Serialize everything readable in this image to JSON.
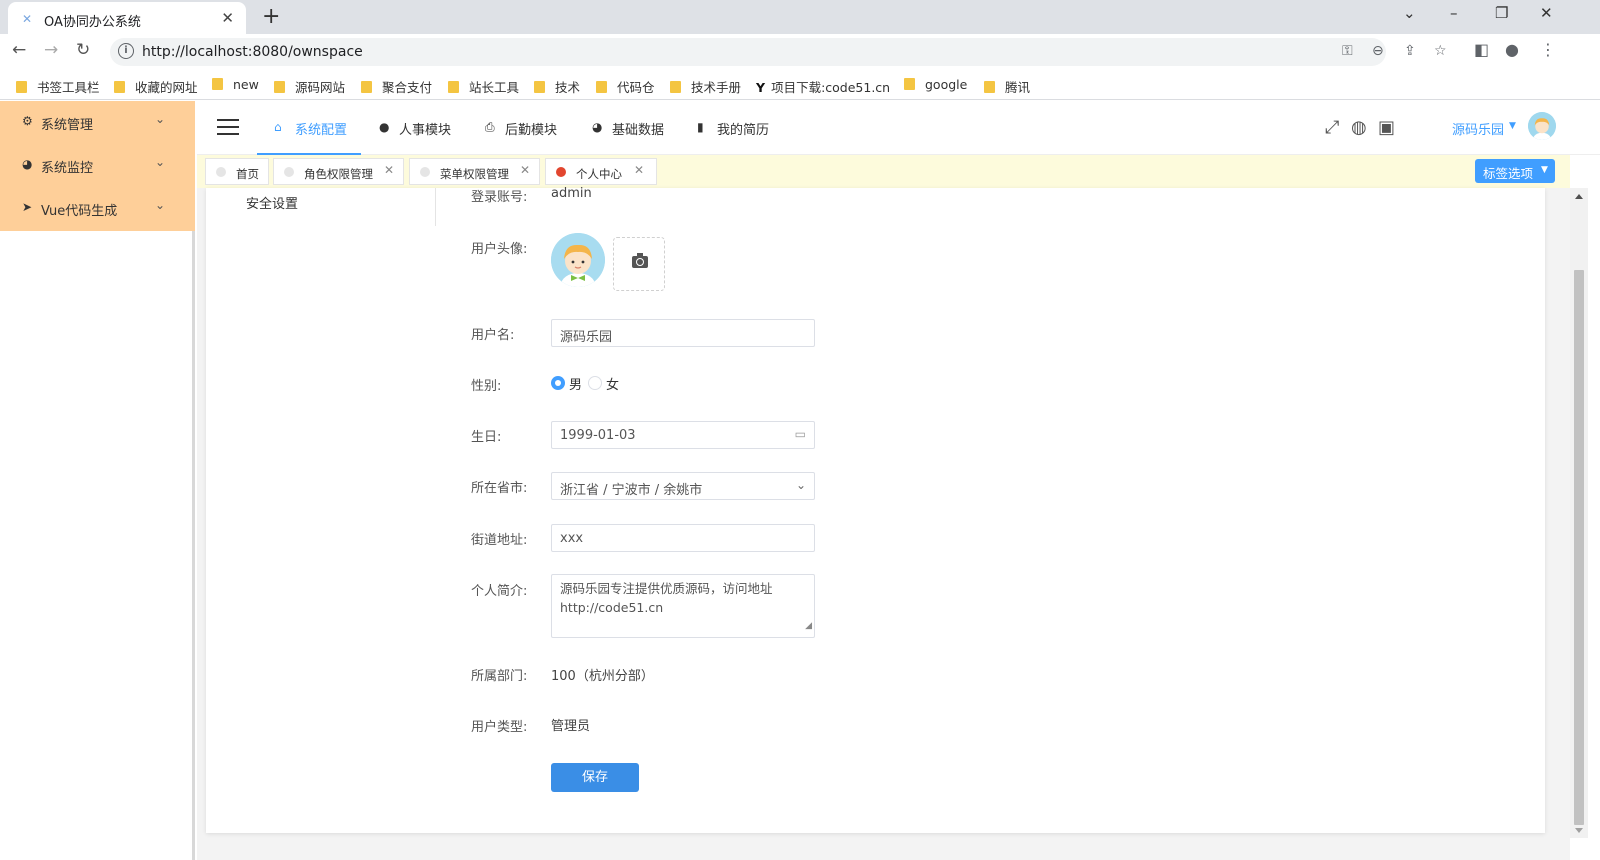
{
  "browser": {
    "tab_title": "OA协同办公系统",
    "tab_favicon": "x-logo-icon",
    "url": "http://localhost:8080/ownspace",
    "bookmarks": [
      "书签工具栏",
      "收藏的网址",
      "new",
      "源码网站",
      "聚合支付",
      "站长工具",
      "技术",
      "代码仓",
      "技术手册",
      "项目下载:code51.cn",
      "google",
      "腾讯"
    ]
  },
  "sidebar": {
    "background": "#fecf99",
    "items": [
      {
        "label": "系统管理",
        "icon": "gear-icon"
      },
      {
        "label": "系统监控",
        "icon": "monitor-icon"
      },
      {
        "label": "Vue代码生成",
        "icon": "send-icon"
      }
    ]
  },
  "header": {
    "nav": [
      {
        "label": "系统配置",
        "icon": "home-icon",
        "active": true
      },
      {
        "label": "人事模块",
        "icon": "chat-icon",
        "active": false
      },
      {
        "label": "后勤模块",
        "icon": "printer-icon",
        "active": false
      },
      {
        "label": "基础数据",
        "icon": "pie-icon",
        "active": false
      },
      {
        "label": "我的简历",
        "icon": "book-icon",
        "active": false
      }
    ],
    "user_name": "源码乐园",
    "accent": "#409eff"
  },
  "tags": {
    "items": [
      {
        "label": "首页",
        "closable": false,
        "active": false
      },
      {
        "label": "角色权限管理",
        "closable": true,
        "active": false
      },
      {
        "label": "菜单权限管理",
        "closable": true,
        "active": false
      },
      {
        "label": "个人中心",
        "closable": true,
        "active": true
      }
    ],
    "options_label": "标签选项",
    "background": "#fdfbdc"
  },
  "profile": {
    "left_menu_item": "安全设置",
    "account_label": "登录账号:",
    "account_value": "admin",
    "avatar_label": "用户头像:",
    "username_label": "用户名:",
    "username_value": "源码乐园",
    "gender_label": "性别:",
    "gender_options": [
      "男",
      "女"
    ],
    "gender_selected": "男",
    "birthday_label": "生日:",
    "birthday_value": "1999-01-03",
    "region_label": "所在省市:",
    "region_value": "浙江省 / 宁波市 / 余姚市",
    "address_label": "街道地址:",
    "address_value": "xxx",
    "bio_label": "个人简介:",
    "bio_line1": "源码乐园专注提供优质源码，访问地址",
    "bio_line2": "http://code51.cn",
    "dept_label": "所属部门:",
    "dept_value": "100（杭州分部）",
    "usertype_label": "用户类型:",
    "usertype_value": "管理员",
    "save_label": "保存"
  }
}
